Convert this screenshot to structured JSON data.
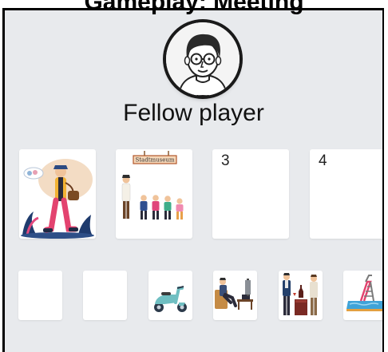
{
  "header": {
    "title": "Gameplay: Meeting"
  },
  "player": {
    "name": "Fellow player",
    "avatar_icon": "man-with-glasses-avatar-icon"
  },
  "card_row": [
    {
      "type": "image",
      "icon": "walking-man-with-bag-illustration"
    },
    {
      "type": "image",
      "icon": "museum-group-illustration",
      "sign_text": "Stadtmuseum"
    },
    {
      "type": "number",
      "label": "3"
    },
    {
      "type": "number",
      "label": "4"
    }
  ],
  "hand_cards": [
    {
      "type": "empty"
    },
    {
      "type": "empty"
    },
    {
      "type": "image",
      "icon": "scooter-illustration"
    },
    {
      "type": "image",
      "icon": "person-watching-tv-illustration"
    },
    {
      "type": "image",
      "icon": "wine-tasting-illustration"
    },
    {
      "type": "image",
      "icon": "swimming-pool-illustration"
    }
  ],
  "colors": {
    "panel_background": "#e8eaed",
    "card_background": "#ffffff",
    "frame": "#000000"
  }
}
